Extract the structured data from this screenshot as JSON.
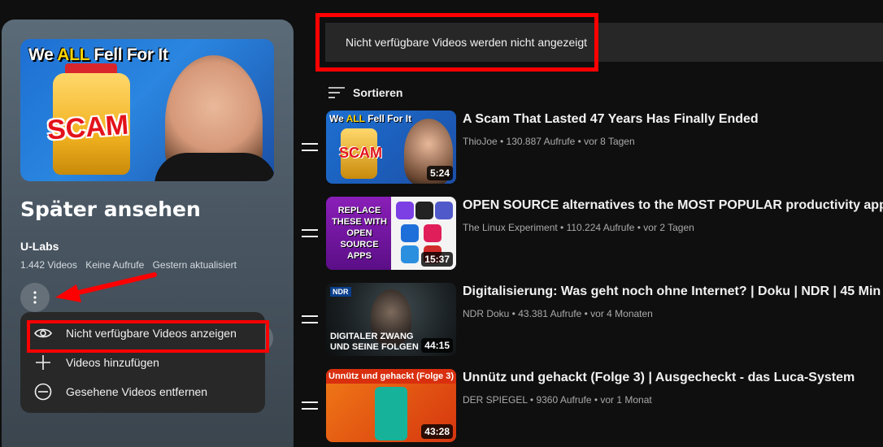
{
  "banner": {
    "text": "Nicht verfügbare Videos werden nicht angezeigt"
  },
  "playlist": {
    "cover_headline_pre": "We ",
    "cover_headline_hl": "ALL",
    "cover_headline_post": " Fell For It",
    "cover_word": "SCAM",
    "title": "Später ansehen",
    "owner": "U-Labs",
    "video_count": "1.442 Videos",
    "views": "Keine Aufrufe",
    "updated": "Gestern aktualisiert"
  },
  "menu": {
    "items": [
      {
        "label": "Nicht verfügbare Videos anzeigen",
        "icon": "eye-icon"
      },
      {
        "label": "Videos hinzufügen",
        "icon": "plus-icon"
      },
      {
        "label": "Gesehene Videos entfernen",
        "icon": "minus-circle-icon"
      }
    ]
  },
  "sort": {
    "label": "Sortieren"
  },
  "videos": [
    {
      "title": "A Scam That Lasted 47 Years Has Finally Ended",
      "meta": "ThioJoe • 130.887 Aufrufe • vor 8 Tagen",
      "duration": "5:24",
      "thumb_headline_pre": "We ",
      "thumb_headline_hl": "ALL",
      "thumb_headline_post": " Fell For It",
      "thumb_word": "SCAM"
    },
    {
      "title": "OPEN SOURCE alternatives to the MOST POPULAR productivity apps!",
      "meta": "The Linux Experiment • 110.224 Aufrufe • vor 2 Tagen",
      "duration": "15:37",
      "thumb_text": "REPLACE THESE WITH OPEN SOURCE APPS"
    },
    {
      "title": "Digitalisierung: Was geht noch ohne Internet? | Doku | NDR | 45 Min",
      "meta": "NDR Doku • 43.381 Aufrufe • vor 4 Monaten",
      "duration": "44:15",
      "thumb_logo": "NDR",
      "thumb_text": "DIGITALER ZWANG UND SEINE FOLGEN"
    },
    {
      "title": "Unnütz und gehackt (Folge 3) | Ausgecheckt - das Luca-System",
      "meta": "DER SPIEGEL • 9360 Aufrufe • vor 1 Monat",
      "duration": "43:28",
      "thumb_header": "Unnütz und gehackt (Folge 3)"
    }
  ],
  "colors": {
    "highlight": "#ff0000",
    "banner_bg": "#272727",
    "menu_bg": "#282828"
  }
}
